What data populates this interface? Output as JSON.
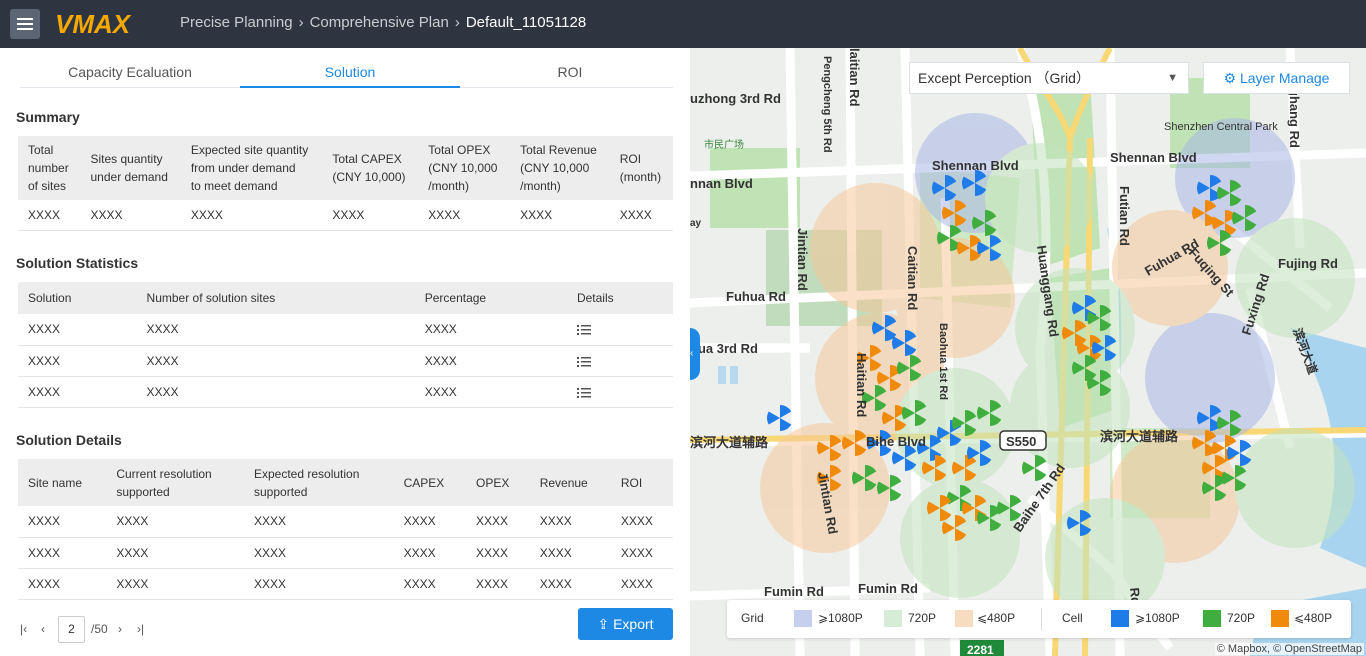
{
  "header": {
    "logo_text": "VMAX",
    "breadcrumb": [
      "Precise Planning",
      "Comprehensive Plan",
      "Default_11051128"
    ]
  },
  "tabs": [
    "Capacity Ecaluation",
    "Solution",
    "ROI"
  ],
  "active_tab": "Solution",
  "summary": {
    "title": "Summary",
    "headers": [
      [
        "Total",
        "number",
        "of sites"
      ],
      [
        "Sites quantity",
        "under demand"
      ],
      [
        "Expected site quantity",
        "from under demand",
        "to meet demand"
      ],
      [
        "Total CAPEX",
        "(CNY 10,000)"
      ],
      [
        "Total OPEX",
        "(CNY 10,000",
        "/month)"
      ],
      [
        "Total Revenue",
        "(CNY 10,000",
        "/month)"
      ],
      [
        "ROI",
        "(month)"
      ]
    ],
    "row": [
      "XXXX",
      "XXXX",
      "XXXX",
      "XXXX",
      "XXXX",
      "XXXX",
      "XXXX"
    ]
  },
  "statistics": {
    "title": "Solution Statistics",
    "headers": [
      "Solution",
      "Number of solution sites",
      "Percentage",
      "Details"
    ],
    "rows": [
      [
        "XXXX",
        "XXXX",
        "XXXX"
      ],
      [
        "XXXX",
        "XXXX",
        "XXXX"
      ],
      [
        "XXXX",
        "XXXX",
        "XXXX"
      ]
    ]
  },
  "details": {
    "title": "Solution Details",
    "headers": [
      [
        "Site name"
      ],
      [
        "Current resolution",
        "supported"
      ],
      [
        "Expected resolution",
        "supported"
      ],
      [
        "CAPEX"
      ],
      [
        "OPEX"
      ],
      [
        "Revenue"
      ],
      [
        "ROI"
      ]
    ],
    "rows": [
      [
        "XXXX",
        "XXXX",
        "XXXX",
        "XXXX",
        "XXXX",
        "XXXX",
        "XXXX"
      ],
      [
        "XXXX",
        "XXXX",
        "XXXX",
        "XXXX",
        "XXXX",
        "XXXX",
        "XXXX"
      ],
      [
        "XXXX",
        "XXXX",
        "XXXX",
        "XXXX",
        "XXXX",
        "XXXX",
        "XXXX"
      ]
    ]
  },
  "pager": {
    "page": "2",
    "total": "/50"
  },
  "export_label": "Export",
  "map": {
    "perception_select": "Except Perception  （Grid）",
    "layer_button": "Layer Manage",
    "legend": {
      "grid_label": "Grid",
      "cell_label": "Cell",
      "grid_items": [
        {
          "label": "⩾1080P",
          "color": "#c6d0ee"
        },
        {
          "label": "720P",
          "color": "#d6ecd6"
        },
        {
          "label": "⩽480P",
          "color": "#f8dcc0"
        }
      ],
      "cell_items": [
        {
          "label": "⩾1080P",
          "color": "#1e7be8"
        },
        {
          "label": "720P",
          "color": "#3fae3f"
        },
        {
          "label": "⩽480P",
          "color": "#f08a0b"
        }
      ]
    },
    "labels": {
      "shennan1": "Shennan Blvd",
      "shennan2": "Shennan Blvd",
      "shennan3": "nnan Blvd",
      "zhuzhong": "uzhong 3rd Rd",
      "fuhua": "Fuhua Rd",
      "fuhua2": "Fuhua Rd",
      "fuhua3": "hua 3rd Rd",
      "fuqing": "Fuqing St",
      "fujing": "Fujing Rd",
      "fuxing": "Fuxing Rd",
      "jintian": "Jintian Rd",
      "jintian2": "Jintian Rd",
      "caitian": "Caitian Rd",
      "huanggang": "Huanggang Rd",
      "baohua": "Baohua 1st Rd",
      "futian": "Futian Rd",
      "haitian": "laitian Rd",
      "pengcheng": "Pengcheng 5th Rd",
      "ghang": "ghang Rd",
      "binhe_cn": "滨河大道辅路",
      "binhe_cn2": "滨河大道辅路",
      "binhe_cn3": "滨河大道",
      "s550": "S550",
      "baihe": "Baihe 7th Rd",
      "fumin": "Fumin Rd",
      "fumin2": "Fumin Rd",
      "shenzhen_park": "Shenzhen Central Park",
      "shimin": "市民广场",
      "bihe": "Bihe Blvd",
      "hanan": "Haitian Rd",
      "n2281": "2281",
      "ay": "ay",
      "rds": "Rd S",
      "rd_partial": "Rd"
    },
    "attribution": "© Mapbox, © OpenStreetMap"
  }
}
